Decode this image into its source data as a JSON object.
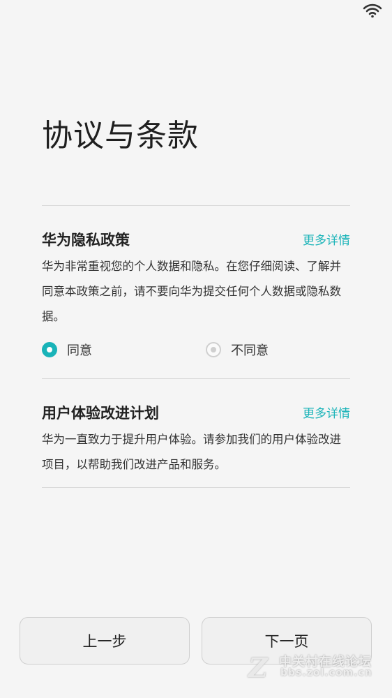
{
  "status_bar": {
    "wifi_icon": "wifi-icon"
  },
  "page": {
    "title": "协议与条款"
  },
  "privacy": {
    "title": "华为隐私政策",
    "more": "更多详情",
    "description": "华为非常重视您的个人数据和隐私。在您仔细阅读、了解并同意本政策之前，请不要向华为提交任何个人数据或隐私数据。",
    "options": [
      {
        "label": "同意",
        "selected": true
      },
      {
        "label": "不同意",
        "selected": false
      }
    ]
  },
  "experience": {
    "title": "用户体验改进计划",
    "more": "更多详情",
    "description": "华为一直致力于提升用户体验。请参加我们的用户体验改进项目，以帮助我们改进产品和服务。"
  },
  "buttons": {
    "prev": "上一步",
    "next": "下一页"
  },
  "watermark": {
    "line1": "中关村在线论坛",
    "line2": "bbs.zol.com.cn",
    "logo": "Z"
  },
  "colors": {
    "accent": "#19b3b8",
    "background": "#f5f5f5",
    "divider": "#d8d8d8"
  }
}
